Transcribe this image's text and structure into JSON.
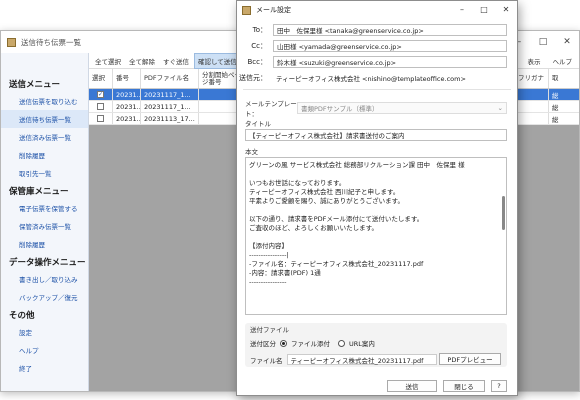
{
  "background_window": {
    "title": "送信待ち伝票一覧",
    "controls": {
      "minimize": "–",
      "maximize": "□",
      "close": "✕"
    },
    "toolbar": [
      "全て選択",
      "全て解除",
      "すぐ送信",
      "確認して送信"
    ],
    "toolbar_right": [
      "表示",
      "ヘルプ"
    ],
    "sidebar": {
      "sections": [
        {
          "heading": "送信メニュー",
          "items": [
            "送信伝票を取り込む",
            "送信待ち伝票一覧",
            "送信済み伝票一覧",
            "削除履歴",
            "取引先一覧"
          ]
        },
        {
          "heading": "保管庫メニュー",
          "items": [
            "電子伝票を保管する",
            "保管済み伝票一覧",
            "削除履歴"
          ]
        },
        {
          "heading": "データ操作メニュー",
          "items": [
            "書き出し／取り込み",
            "バックアップ／復元"
          ]
        },
        {
          "heading": "その他",
          "items": [
            "設定",
            "ヘルプ",
            "終了"
          ]
        }
      ],
      "active_item": "送信待ち伝票一覧"
    },
    "table": {
      "columns": [
        "選択",
        "番号",
        "PDFファイル名",
        "分割開始ページ番号"
      ],
      "rows": [
        {
          "selected": true,
          "number": "20231...",
          "file": "20231117_1..."
        },
        {
          "selected": false,
          "number": "20231...",
          "file": "20231117_1..."
        },
        {
          "selected": false,
          "number": "20231...",
          "file": "20231113_17..."
        }
      ]
    },
    "right_table": {
      "columns": [
        "",
        "フリガナ",
        "取"
      ],
      "rows": [
        {
          "c1": "",
          "c2": "",
          "c3": "総"
        },
        {
          "c1": "",
          "c2": "",
          "c3": "総"
        },
        {
          "c1": "",
          "c2": "",
          "c3": "総"
        }
      ]
    }
  },
  "dialog": {
    "title": "メール設定",
    "controls": {
      "minimize": "–",
      "maximize": "□",
      "close": "✕"
    },
    "to_label": "To：",
    "to_value": "田中　佐保里様 <tanaka@greenservice.co.jp>",
    "cc_label": "Cc：",
    "cc_value": "山田様 <yamada@greenservice.co.jp>",
    "bcc_label": "Bcc：",
    "bcc_value": "鈴木様 <suzuki@greenservice.co.jp>",
    "from_label": "送信元：",
    "from_value": "ティーピーオフィス株式会社 <nishino@templateoffice.com>",
    "template_label": "メールテンプレート：",
    "template_value": "書類PDFサンプル（標準）",
    "subject_label": "タイトル",
    "subject_value": "【ティーピーオフィス株式会社】請求書送付のご案内",
    "body_label": "本文",
    "body_lines": [
      "グリーンの風 サービス株式会社 総務部リクルーション課 田中　佐保里 様",
      "",
      "いつもお世話になっております。",
      "ティーピーオフィス株式会社 西川紀子と申します。",
      "平素よりご愛顧を賜り、誠にありがとうございます。",
      "",
      "以下の通り、請求書をPDFメール添付にて送付いたします。",
      "ご査収のほど、よろしくお願いいたします。",
      "",
      "【添付内容】",
      "----------------|",
      "-ファイル名：ティーピーオフィス株式会社_20231117.pdf",
      "-内容：請求書(PDF) 1通",
      "----------------",
      ""
    ],
    "attachment": {
      "section_label": "送付ファイル",
      "type_label": "送付区分",
      "option_file": "ファイル添付",
      "option_url": "URL案内",
      "selected": "ファイル添付",
      "file_name_label": "ファイル名",
      "file_name": "ティーピーオフィス株式会社_20231117.pdf",
      "preview_button": "PDFプレビュー"
    },
    "buttons": {
      "send": "送信",
      "close": "閉じる",
      "help": "?"
    }
  }
}
